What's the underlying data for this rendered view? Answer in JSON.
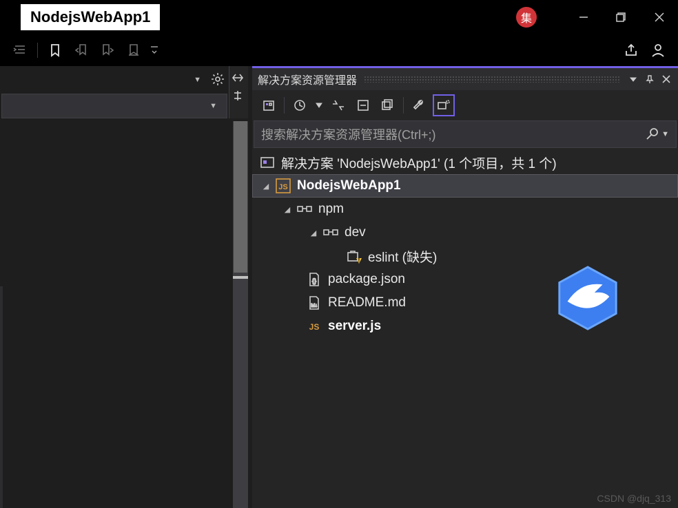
{
  "titlebar": {
    "title": "NodejsWebApp1",
    "badge_text": "集"
  },
  "panel": {
    "title": "解决方案资源管理器",
    "search_placeholder": "搜索解决方案资源管理器(Ctrl+;)"
  },
  "tree": {
    "solution_label": "解决方案 'NodejsWebApp1' (1 个项目，共 1 个)",
    "project_label": "NodejsWebApp1",
    "npm_label": "npm",
    "dev_label": "dev",
    "eslint_label": "eslint (缺失)",
    "package_label": "package.json",
    "readme_label": "README.md",
    "server_label": "server.js"
  },
  "watermark": "CSDN @djq_313"
}
